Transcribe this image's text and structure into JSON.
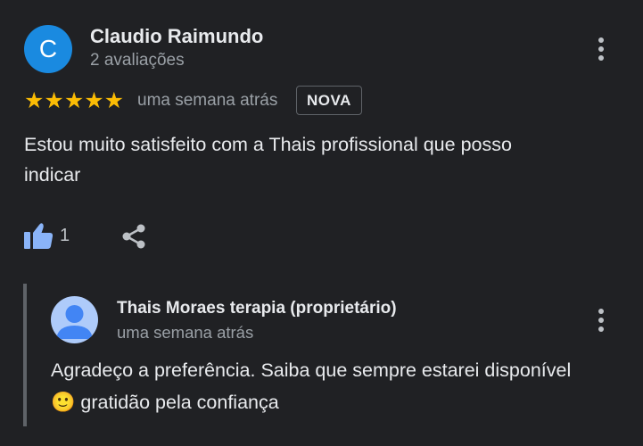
{
  "review": {
    "avatar_letter": "C",
    "avatar_color": "#1a8ae0",
    "author_name": "Claudio Raimundo",
    "review_count": "2 avaliações",
    "rating": 5,
    "stars_text": "★★★★★",
    "time": "uma semana atrás",
    "badge": "NOVA",
    "text_line1": "Estou muito satisfeito com a Thais profissional que posso",
    "text_line2": "indicar",
    "like_count": "1",
    "menu_icon": "more-vert-icon",
    "like_icon": "thumb-up-icon",
    "share_icon": "share-icon"
  },
  "reply": {
    "owner_name": "Thais Moraes terapia (proprietário)",
    "time": "uma semana atrás",
    "text_line1": "Agradeço a preferência. Saiba que sempre estarei disponível",
    "emoji": "🙂",
    "text_line2": " gratidão pela confiança",
    "avatar_icon": "default-person-avatar-icon",
    "menu_icon": "more-vert-icon"
  },
  "colors": {
    "background": "#202124",
    "star": "#fbbc04",
    "like_icon": "#8ab4f8",
    "secondary_text": "#9aa0a6"
  }
}
